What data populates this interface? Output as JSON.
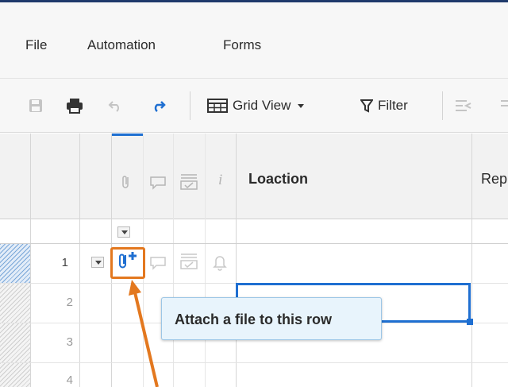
{
  "menu": {
    "file": "File",
    "automation": "Automation",
    "forms": "Forms"
  },
  "toolbar": {
    "grid_view": "Grid View",
    "filter": "Filter"
  },
  "grid": {
    "column_primary": "Loaction",
    "column_next": "Rep",
    "header_info": "i",
    "rows": [
      "1",
      "2",
      "3",
      "4"
    ]
  },
  "tooltip": {
    "text": "Attach a file to this row"
  },
  "colors": {
    "accent": "#1f6fd1",
    "highlight": "#e3781f",
    "tooltip_bg": "#e8f4fc"
  }
}
